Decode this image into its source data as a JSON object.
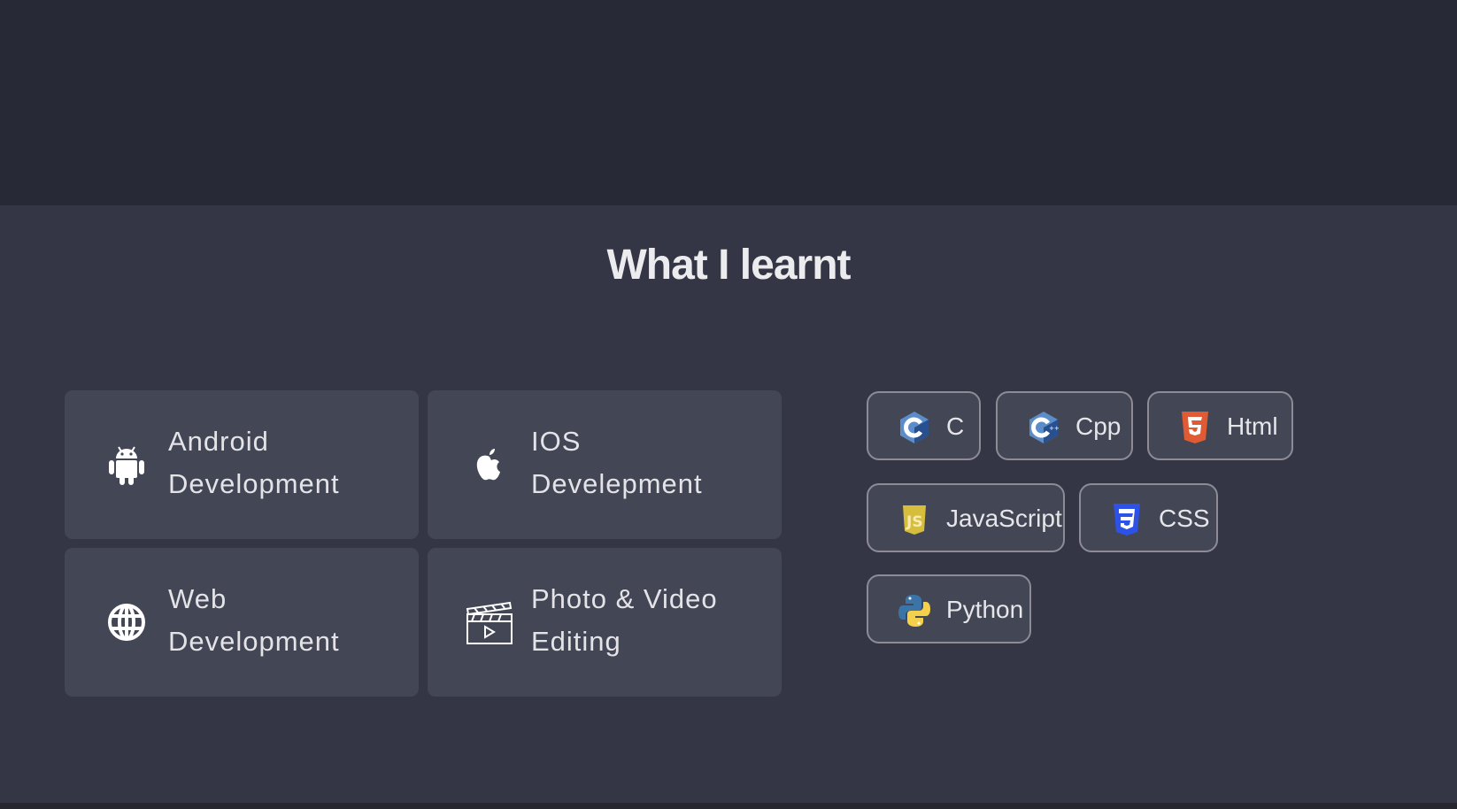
{
  "section": {
    "title": "What I learnt"
  },
  "cards": [
    {
      "line1": "Android",
      "line2": "Development",
      "icon": "android-icon"
    },
    {
      "line1": "IOS",
      "line2": "Develepment",
      "icon": "apple-icon"
    },
    {
      "line1": "Web",
      "line2": "Development",
      "icon": "globe-icon"
    },
    {
      "line1": "Photo & Video",
      "line2": "Editing",
      "icon": "clapperboard-icon"
    }
  ],
  "skills": [
    {
      "label": "C",
      "icon": "c-logo-icon",
      "color": "#5c8dc9"
    },
    {
      "label": "Cpp",
      "icon": "cpp-logo-icon",
      "color": "#5c8dc9"
    },
    {
      "label": "Html",
      "icon": "html5-logo-icon",
      "color": "#e05a33"
    },
    {
      "label": "JavaScript",
      "icon": "js-logo-icon",
      "color": "#d6bd3c"
    },
    {
      "label": "CSS",
      "icon": "css3-logo-icon",
      "color": "#2d52e8"
    },
    {
      "label": "Python",
      "icon": "python-logo-icon",
      "color": "#3d74a8"
    }
  ]
}
